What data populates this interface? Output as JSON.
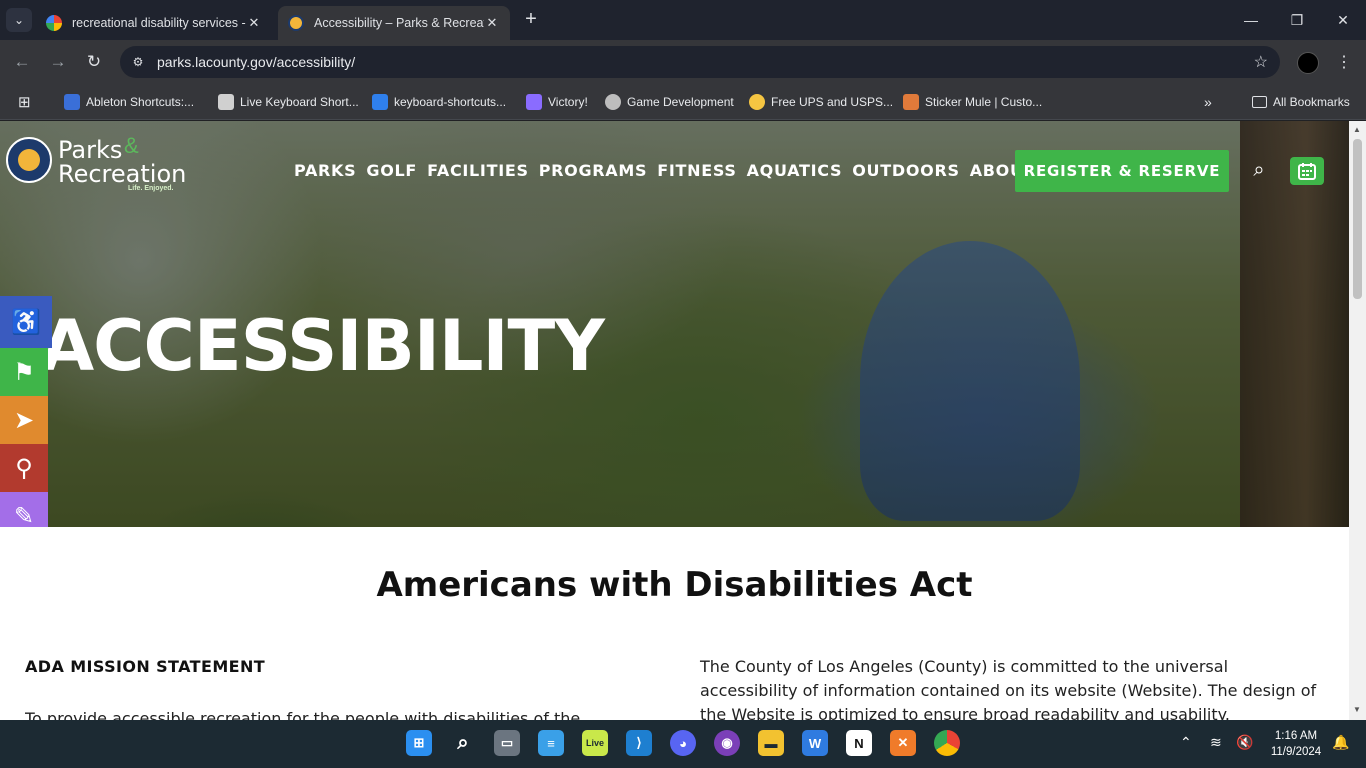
{
  "browser": {
    "tabs": [
      {
        "title": "recreational disability services -",
        "active": false
      },
      {
        "title": "Accessibility – Parks & Recreatio",
        "active": true
      }
    ],
    "url": "parks.lacounty.gov/accessibility/",
    "bookmarks": [
      {
        "label": "Ableton Shortcuts:...",
        "color": "#3a6fd8"
      },
      {
        "label": "Live Keyboard Short...",
        "color": "#d0d0d0"
      },
      {
        "label": "keyboard-shortcuts...",
        "color": "#2f80ed"
      },
      {
        "label": "Victory!",
        "color": "#8a6cff"
      },
      {
        "label": "Game Development",
        "color": "#bdbdbd"
      },
      {
        "label": "Free UPS and USPS...",
        "color": "#f5c542"
      },
      {
        "label": "Sticker Mule | Custo...",
        "color": "#e07a3a"
      }
    ],
    "all_bookmarks": "All Bookmarks",
    "overflow": "»"
  },
  "site": {
    "logo": {
      "line1": "Parks",
      "line2": "Recreation",
      "amp": "&",
      "tagline": "Life. Enjoyed."
    },
    "nav": [
      "PARKS",
      "GOLF",
      "FACILITIES",
      "PROGRAMS",
      "FITNESS",
      "AQUATICS",
      "OUTDOORS",
      "ABOUT US"
    ],
    "register_button": "REGISTER & RESERVE",
    "hero_title": "ACCESSIBILITY",
    "accessibility_toolbar": [
      {
        "icon": "accessibility-icon",
        "color": "#3a5bbf",
        "glyph": "♿"
      },
      {
        "icon": "flag-icon",
        "color": "#3fb549",
        "glyph": "⚑"
      },
      {
        "icon": "cursor-icon",
        "color": "#e08a2e",
        "glyph": "➤"
      },
      {
        "icon": "pin-icon",
        "color": "#b23a2e",
        "glyph": "⚲"
      },
      {
        "icon": "pencil-icon",
        "color": "#a36ee8",
        "glyph": "✎"
      }
    ]
  },
  "content": {
    "heading": "Americans with Disabilities Act",
    "mission_title": "ADA MISSION STATEMENT",
    "mission_text": "To provide accessible recreation for the people with disabilities of the",
    "right_text": "The County of Los Angeles (County) is committed to the universal accessibility of information contained on its website (Website). The design of the Website is optimized to ensure broad readability and usability."
  },
  "taskbar": {
    "time": "1:16 AM",
    "date": "11/9/2024",
    "apps": [
      {
        "name": "start-icon",
        "color": "#2b8ff0",
        "glyph": "⊞"
      },
      {
        "name": "search-icon",
        "color": "transparent",
        "glyph": "⌕"
      },
      {
        "name": "task-view-icon",
        "color": "#6b7580",
        "glyph": "▭"
      },
      {
        "name": "notepad-icon",
        "color": "#3aa0e8",
        "glyph": "≡"
      },
      {
        "name": "ableton-live-icon",
        "color": "#c9e84a",
        "glyph": "Live"
      },
      {
        "name": "vscode-icon",
        "color": "#1e7fd0",
        "glyph": "⟩"
      },
      {
        "name": "discord-icon",
        "color": "#5865f2",
        "glyph": "◕"
      },
      {
        "name": "github-icon",
        "color": "#7b3fb8",
        "glyph": "◉"
      },
      {
        "name": "file-explorer-icon",
        "color": "#f2c230",
        "glyph": "▬"
      },
      {
        "name": "word-icon",
        "color": "#2f7be0",
        "glyph": "W"
      },
      {
        "name": "notion-icon",
        "color": "#ffffff",
        "glyph": "N"
      },
      {
        "name": "xampp-icon",
        "color": "#f07b2a",
        "glyph": "✕"
      },
      {
        "name": "chrome-icon",
        "color": "#3b8a3e",
        "glyph": "◎"
      }
    ]
  }
}
